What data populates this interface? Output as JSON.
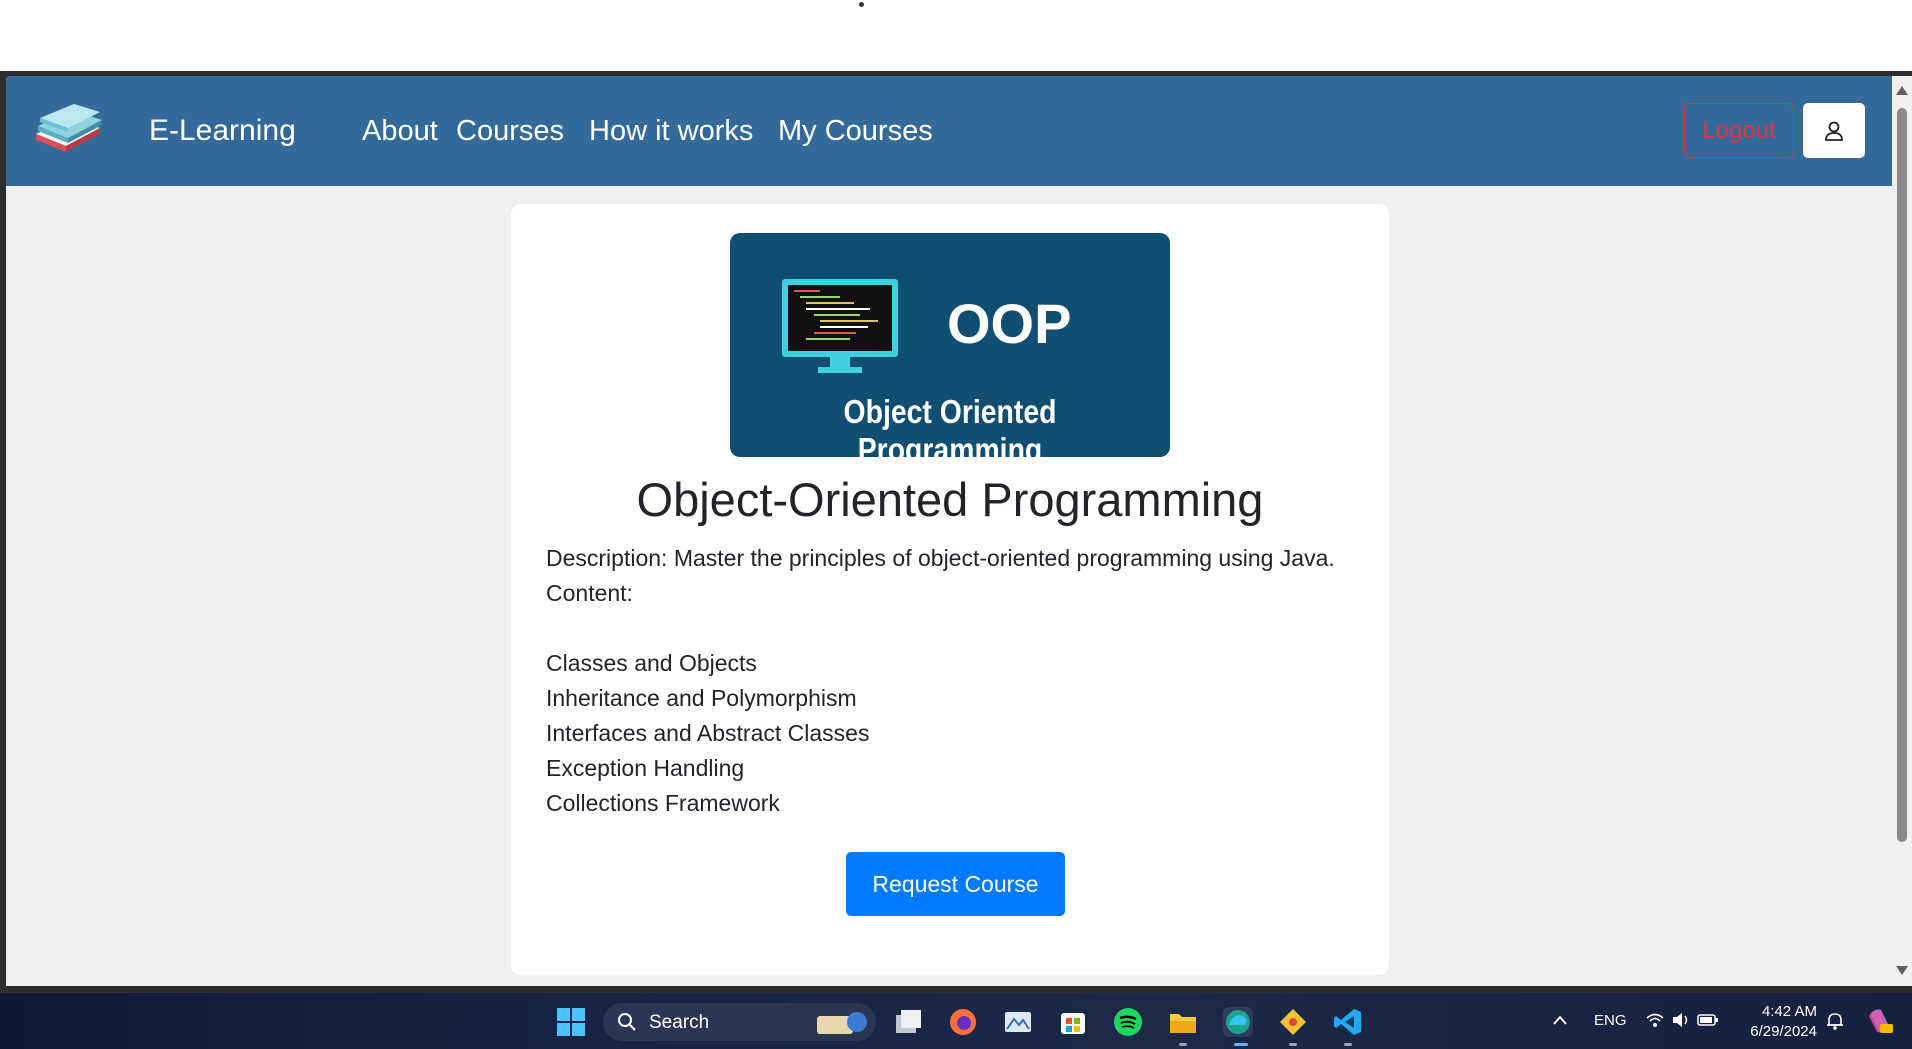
{
  "navbar": {
    "brand_name": "E-Learning",
    "links": [
      "About",
      "Courses",
      "How it works",
      "My Courses"
    ],
    "logout_label": "Logout",
    "color": "#336a99"
  },
  "course": {
    "banner_title": "OOP",
    "banner_subtitle": "Object Oriented Programming",
    "title": "Object-Oriented Programming",
    "description": "Description: Master the principles of object-oriented programming using Java.",
    "content_label": "Content:",
    "topics": [
      "Classes and Objects",
      "Inheritance and Polymorphism",
      "Interfaces and Abstract Classes",
      "Exception Handling",
      "Collections Framework"
    ],
    "request_label": "Request Course",
    "accent_color": "#007bff"
  },
  "taskbar": {
    "search_label": "Search",
    "language": "ENG",
    "time": "4:42 AM",
    "date": "6/29/2024",
    "pinned_apps": [
      "start-icon",
      "search-icon",
      "task-view-icon",
      "firefox-icon",
      "photos-icon",
      "store-icon",
      "spotify-icon",
      "file-explorer-icon",
      "edge-icon",
      "git-icon",
      "vscode-icon"
    ]
  }
}
